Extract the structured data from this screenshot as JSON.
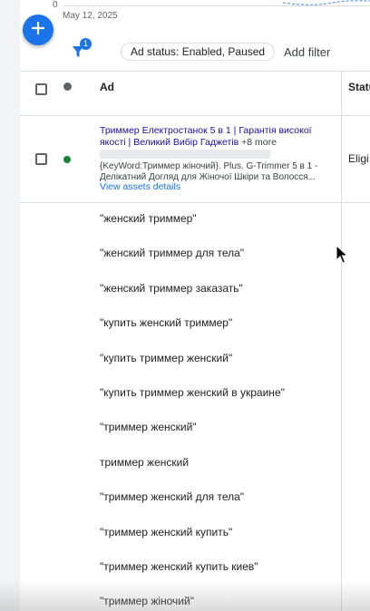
{
  "chart": {
    "zero_label": "0",
    "date_label": "May 12, 2025"
  },
  "fab": {
    "icon": "plus-icon"
  },
  "filter_bar": {
    "filter_icon": "funnel-icon",
    "filter_count": "1",
    "status_chip": "Ad status: Enabled, Paused",
    "add_filter": "Add filter"
  },
  "table": {
    "headers": {
      "ad": "Ad",
      "status": "Statu"
    }
  },
  "ad": {
    "headline": "Триммер Електростанок 5 в 1 | Гарантія високої якості | Великий Вибір Гаджетів",
    "more": "+8 more",
    "desc_1": "{KeyWord:Триммер жіночий}. Plus. G-Trimmer 5 в 1 -",
    "desc_2": "Делікатний Догляд для Жіночої Шкіри та Волосся...",
    "assets_link": "View assets details",
    "status": "Eligi",
    "status_color": "#188038"
  },
  "keywords": [
    "\"женский триммер\"",
    "\"женский триммер для тела\"",
    "\"женский триммер заказать\"",
    "\"купить женский триммер\"",
    "\"купить триммер женский\"",
    "\"купить триммер женский в украине\"",
    "\"триммер женский\"",
    "триммер женский",
    "\"триммер женский для тела\"",
    "\"триммер женский купить\"",
    "\"триммер женский купить киев\"",
    "\"триммер жіночий\""
  ],
  "colors": {
    "accent": "#1a73e8",
    "link": "#1a0dab",
    "eligible": "#188038"
  }
}
